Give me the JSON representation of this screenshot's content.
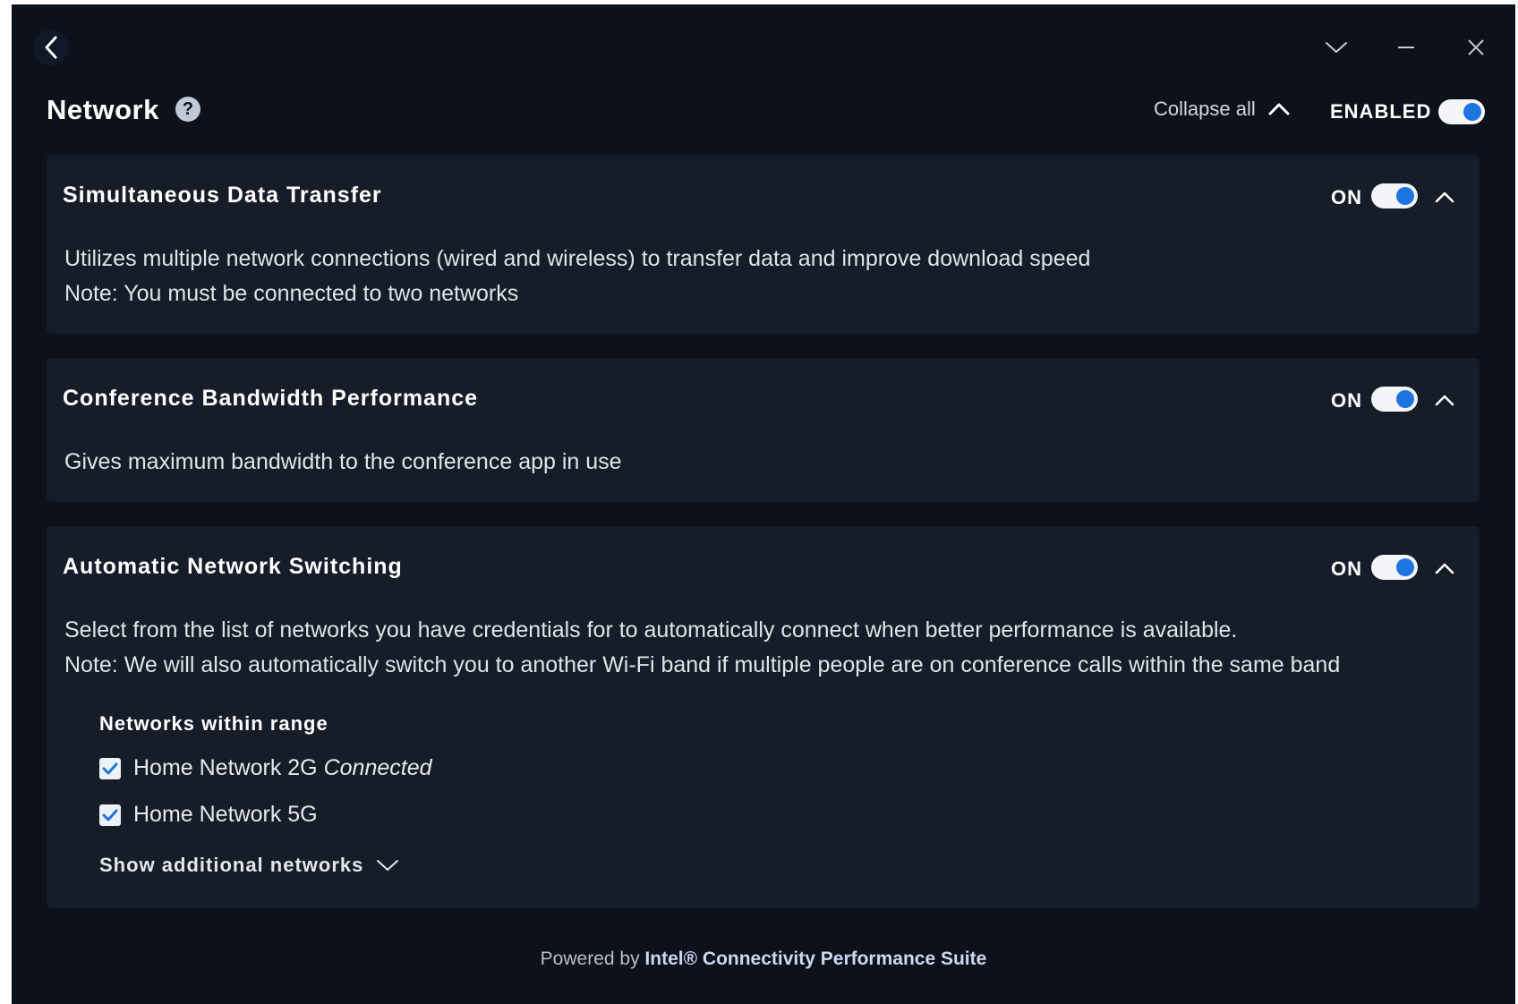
{
  "window": {
    "back_icon": "chevron-left-icon",
    "controls": [
      "chevron-down-icon",
      "minimize-icon",
      "close-icon"
    ]
  },
  "header": {
    "title": "Network",
    "help_icon": "?",
    "collapse_all_label": "Collapse all",
    "master_toggle_label": "ENABLED",
    "master_toggle_on": true
  },
  "sections": [
    {
      "title": "Simultaneous Data Transfer",
      "toggle_label": "ON",
      "toggle_on": true,
      "expanded": true,
      "description": [
        "Utilizes multiple network connections (wired and wireless) to transfer data and improve download speed",
        "Note: You must be connected to two networks"
      ]
    },
    {
      "title": "Conference Bandwidth Performance",
      "toggle_label": "ON",
      "toggle_on": true,
      "expanded": true,
      "description": [
        "Gives maximum bandwidth to the conference app in use"
      ]
    },
    {
      "title": "Automatic Network Switching",
      "toggle_label": "ON",
      "toggle_on": true,
      "expanded": true,
      "description": [
        "Select from the list of networks you have credentials for to automatically connect when better performance is available.",
        "Note: We will also automatically switch you to another Wi-Fi band if multiple people are on conference calls within the same band"
      ],
      "networks_heading": "Networks within range",
      "networks": [
        {
          "name": "Home Network 2G",
          "status": "Connected",
          "checked": true
        },
        {
          "name": "Home Network 5G",
          "status": "",
          "checked": true
        }
      ],
      "show_more_label": "Show additional networks"
    }
  ],
  "footer": {
    "prefix": "Powered by",
    "brand": "Intel® Connectivity Performance Suite"
  },
  "colors": {
    "background": "#0c111b",
    "card": "#171d28",
    "accent": "#1f75e0"
  }
}
